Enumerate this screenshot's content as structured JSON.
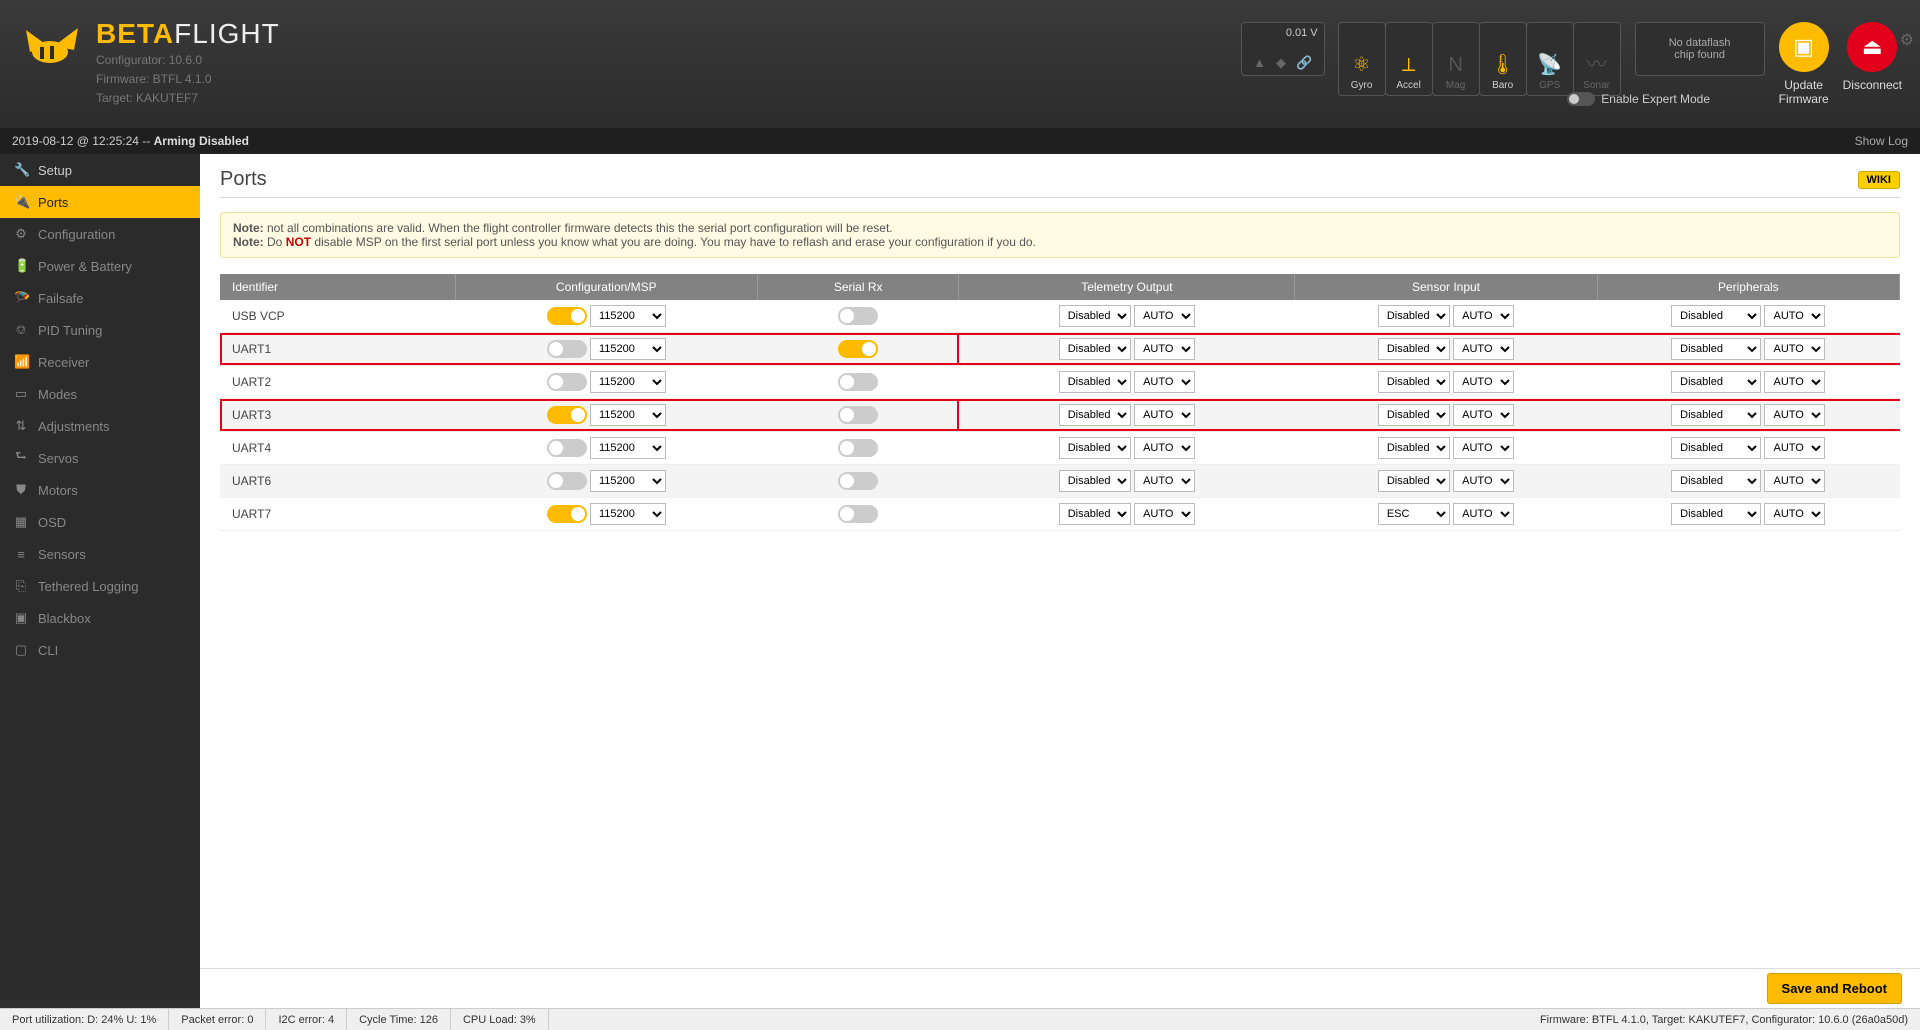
{
  "window": {
    "min": "—",
    "max": "▢",
    "close": "✕"
  },
  "brand": {
    "beta": "BETA",
    "flight": "FLIGHT"
  },
  "subinfo": {
    "configurator": "Configurator: 10.6.0",
    "firmware": "Firmware: BTFL 4.1.0",
    "target": "Target: KAKUTEF7"
  },
  "battery": {
    "volt": "0.01 V"
  },
  "sensors": [
    {
      "key": "gyro",
      "label": "Gyro",
      "icon": "⚛",
      "on": true
    },
    {
      "key": "accel",
      "label": "Accel",
      "icon": "⟂",
      "on": true
    },
    {
      "key": "mag",
      "label": "Mag",
      "icon": "N",
      "on": false
    },
    {
      "key": "baro",
      "label": "Baro",
      "icon": "🌡",
      "on": true
    },
    {
      "key": "gps",
      "label": "GPS",
      "icon": "📡",
      "on": false
    },
    {
      "key": "sonar",
      "label": "Sonar",
      "icon": "〰",
      "on": false
    }
  ],
  "dataflash": {
    "line1": "No dataflash",
    "line2": "chip found"
  },
  "expert": {
    "label": "Enable Expert Mode"
  },
  "actions": {
    "update": {
      "label": "Update\nFirmware"
    },
    "disconnect": {
      "label": "Disconnect"
    }
  },
  "gear": "⚙",
  "statusbar": {
    "timestamp": "2019-08-12 @ 12:25:24 --",
    "status": "Arming Disabled",
    "showlog": "Show Log"
  },
  "sidebar": [
    {
      "icon": "🔧",
      "label": "Setup"
    },
    {
      "icon": "🔌",
      "label": "Ports"
    },
    {
      "icon": "⚙",
      "label": "Configuration"
    },
    {
      "icon": "🔋",
      "label": "Power & Battery"
    },
    {
      "icon": "🪂",
      "label": "Failsafe"
    },
    {
      "icon": "⎊",
      "label": "PID Tuning"
    },
    {
      "icon": "📶",
      "label": "Receiver"
    },
    {
      "icon": "▭",
      "label": "Modes"
    },
    {
      "icon": "⇅",
      "label": "Adjustments"
    },
    {
      "icon": "⮑",
      "label": "Servos"
    },
    {
      "icon": "⛊",
      "label": "Motors"
    },
    {
      "icon": "▦",
      "label": "OSD"
    },
    {
      "icon": "≡",
      "label": "Sensors"
    },
    {
      "icon": "⎘",
      "label": "Tethered Logging"
    },
    {
      "icon": "▣",
      "label": "Blackbox"
    },
    {
      "icon": "▢",
      "label": "CLI"
    }
  ],
  "page": {
    "title": "Ports",
    "wiki": "WIKI",
    "note1a": "Note:",
    "note1b": " not all combinations are valid. When the flight controller firmware detects this the serial port configuration will be reset.",
    "note2a": "Note:",
    "note2b": " Do ",
    "note2c": "NOT",
    "note2d": " disable MSP on the first serial port unless you know what you are doing. You may have to reflash and erase your configuration if you do."
  },
  "table": {
    "headers": [
      "Identifier",
      "Configuration/MSP",
      "Serial Rx",
      "Telemetry Output",
      "Sensor Input",
      "Peripherals"
    ],
    "rows": [
      {
        "id": "USB VCP",
        "msp_on": true,
        "baud": "115200",
        "rx_on": false,
        "tel": "Disabled",
        "tel_baud": "AUTO",
        "sen": "Disabled",
        "sen_baud": "AUTO",
        "per": "Disabled",
        "per_baud": "AUTO",
        "hl": false,
        "alt": false
      },
      {
        "id": "UART1",
        "msp_on": false,
        "baud": "115200",
        "rx_on": true,
        "tel": "Disabled",
        "tel_baud": "AUTO",
        "sen": "Disabled",
        "sen_baud": "AUTO",
        "per": "Disabled",
        "per_baud": "AUTO",
        "hl": true,
        "alt": true
      },
      {
        "id": "UART2",
        "msp_on": false,
        "baud": "115200",
        "rx_on": false,
        "tel": "Disabled",
        "tel_baud": "AUTO",
        "sen": "Disabled",
        "sen_baud": "AUTO",
        "per": "Disabled",
        "per_baud": "AUTO",
        "hl": false,
        "alt": false
      },
      {
        "id": "UART3",
        "msp_on": true,
        "baud": "115200",
        "rx_on": false,
        "tel": "Disabled",
        "tel_baud": "AUTO",
        "sen": "Disabled",
        "sen_baud": "AUTO",
        "per": "Disabled",
        "per_baud": "AUTO",
        "hl": true,
        "alt": true
      },
      {
        "id": "UART4",
        "msp_on": false,
        "baud": "115200",
        "rx_on": false,
        "tel": "Disabled",
        "tel_baud": "AUTO",
        "sen": "Disabled",
        "sen_baud": "AUTO",
        "per": "Disabled",
        "per_baud": "AUTO",
        "hl": false,
        "alt": false
      },
      {
        "id": "UART6",
        "msp_on": false,
        "baud": "115200",
        "rx_on": false,
        "tel": "Disabled",
        "tel_baud": "AUTO",
        "sen": "Disabled",
        "sen_baud": "AUTO",
        "per": "Disabled",
        "per_baud": "AUTO",
        "hl": false,
        "alt": true
      },
      {
        "id": "UART7",
        "msp_on": true,
        "baud": "115200",
        "rx_on": false,
        "tel": "Disabled",
        "tel_baud": "AUTO",
        "sen": "ESC",
        "sen_baud": "AUTO",
        "per": "Disabled",
        "per_baud": "AUTO",
        "hl": false,
        "alt": false
      }
    ]
  },
  "save_btn": "Save and Reboot",
  "footer": {
    "port_util": "Port utilization: D: 24% U: 1%",
    "pkt_err": "Packet error: 0",
    "i2c_err": "I2C error: 4",
    "cycle": "Cycle Time: 126",
    "cpu": "CPU Load: 3%",
    "fw": "Firmware: BTFL 4.1.0, Target: KAKUTEF7, Configurator: 10.6.0 (26a0a50d)"
  }
}
